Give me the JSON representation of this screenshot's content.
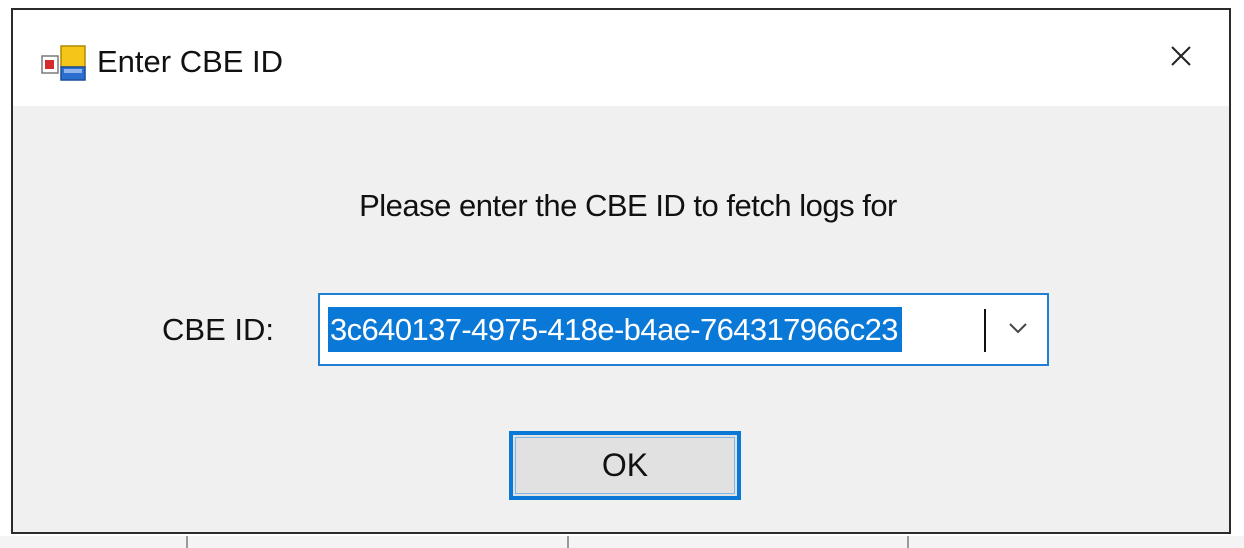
{
  "dialog": {
    "title": "Enter CBE ID",
    "app_icon": "windows-form-app-icon",
    "close_icon": "close-icon"
  },
  "prompt": "Please enter the CBE ID to fetch logs for",
  "field": {
    "label": "CBE ID:",
    "value": "3c640137-4975-418e-b4ae-764317966c23",
    "dropdown_icon": "chevron-down-icon"
  },
  "ok_button": {
    "label": "OK"
  },
  "colors": {
    "accent": "#0a78d6",
    "dialog_bg": "#f0f0f0"
  }
}
